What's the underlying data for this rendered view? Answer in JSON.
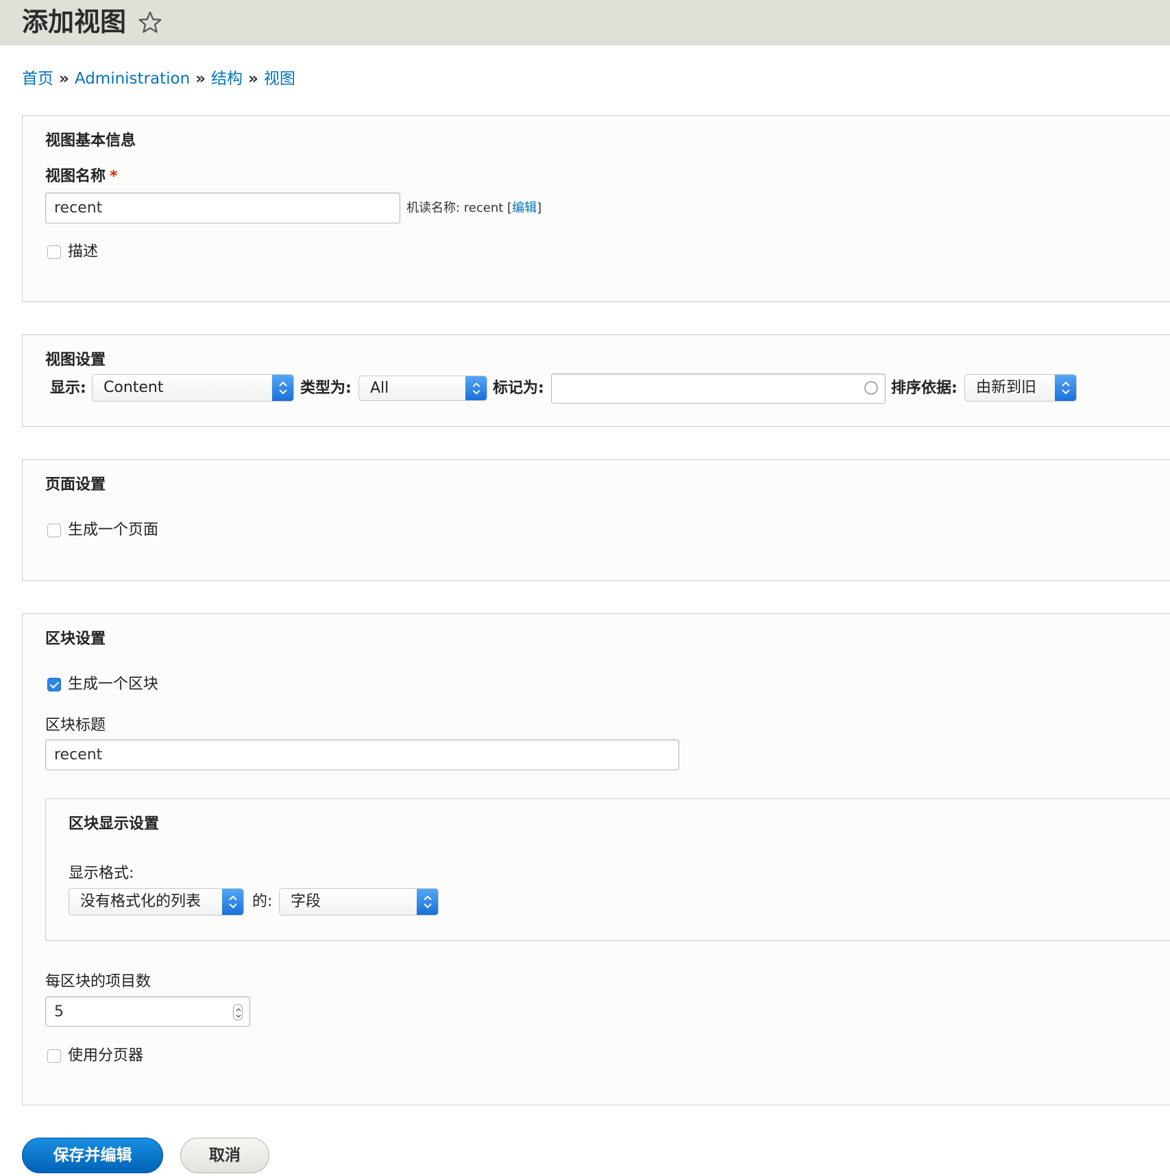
{
  "page": {
    "title": "添加视图",
    "breadcrumb": [
      "首页",
      "Administration",
      "结构",
      "视图"
    ],
    "breadcrumb_sep": "»"
  },
  "basic_info": {
    "legend": "视图基本信息",
    "name_label": "视图名称",
    "required_mark": "*",
    "name_value": "recent",
    "machine_name_label": "机读名称: recent",
    "machine_edit_link": "编辑",
    "bracket_open": "[",
    "bracket_close": "]",
    "description_label": "描述",
    "description_checked": false
  },
  "view_settings": {
    "legend": "视图设置",
    "show_label": "显示:",
    "show_value": "Content",
    "type_label": "类型为:",
    "type_value": "All",
    "tagged_label": "标记为:",
    "tagged_value": "",
    "sort_label": "排序依据:",
    "sort_value": "由新到旧"
  },
  "page_settings": {
    "legend": "页面设置",
    "create_page_label": "生成一个页面",
    "create_page_checked": false
  },
  "block_settings": {
    "legend": "区块设置",
    "create_block_label": "生成一个区块",
    "create_block_checked": true,
    "block_title_label": "区块标题",
    "block_title_value": "recent",
    "display": {
      "legend": "区块显示设置",
      "format_label": "显示格式:",
      "format_value": "没有格式化的列表",
      "of_label": "的:",
      "of_value": "字段"
    },
    "items_label": "每区块的项目数",
    "items_value": "5",
    "pager_label": "使用分页器",
    "pager_checked": false
  },
  "actions": {
    "save_label": "保存并编辑",
    "cancel_label": "取消"
  },
  "colors": {
    "link": "#0074bd",
    "primary": "#0074bd",
    "required": "#e32700",
    "title_bar": "#e0dfd8"
  },
  "icons": {
    "favorite": "star-icon",
    "select": "chevron-updown-icon",
    "autocomplete": "throbber-icon",
    "spinner": "number-spinner-icon"
  }
}
